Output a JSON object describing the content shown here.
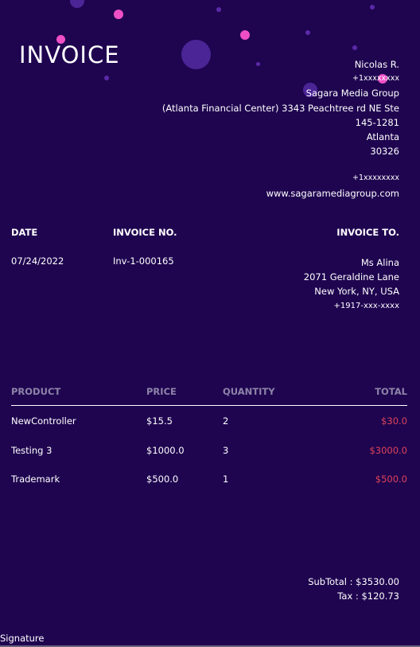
{
  "header": {
    "title": "INVOICE"
  },
  "sender": {
    "name": "Nicolas R.",
    "phone": "+1xxxxxxxx",
    "company": "Sagara Media Group",
    "address_line1": "(Atlanta Financial Center) 3343 Peachtree rd NE Ste",
    "address_line2": "145-1281",
    "city": "Atlanta",
    "zip": "30326",
    "contact_phone": "+1xxxxxxxx",
    "website": "www.sagaramediagroup.com"
  },
  "meta": {
    "date_label": "DATE",
    "date_value": "07/24/2022",
    "invoice_no_label": "INVOICE NO.",
    "invoice_no_value": "Inv-1-000165",
    "invoice_to_label": "INVOICE TO."
  },
  "bill_to": {
    "name": "Ms Alina",
    "street": "2071 Geraldine Lane",
    "city": "New York, NY, USA",
    "phone": "+1917-xxx-xxxx"
  },
  "table": {
    "headers": [
      "PRODUCT",
      "PRICE",
      "QUANTITY",
      "TOTAL"
    ],
    "rows": [
      {
        "product": "NewController",
        "price": "$15.5",
        "quantity": "2",
        "total": "$30.0"
      },
      {
        "product": "Testing 3",
        "price": "$1000.0",
        "quantity": "3",
        "total": "$3000.0"
      },
      {
        "product": "Trademark",
        "price": "$500.0",
        "quantity": "1",
        "total": "$500.0"
      }
    ]
  },
  "totals": {
    "subtotal": "SubTotal : $3530.00",
    "tax": "Tax : $120.73"
  },
  "footer": {
    "signature_label": "Signature"
  },
  "colors": {
    "background": "#1f0550",
    "total_accent": "#e04358",
    "header_muted": "#8d84a8",
    "dot_pink": "#ef4fc6",
    "dot_purple": "#5a2aa8"
  }
}
